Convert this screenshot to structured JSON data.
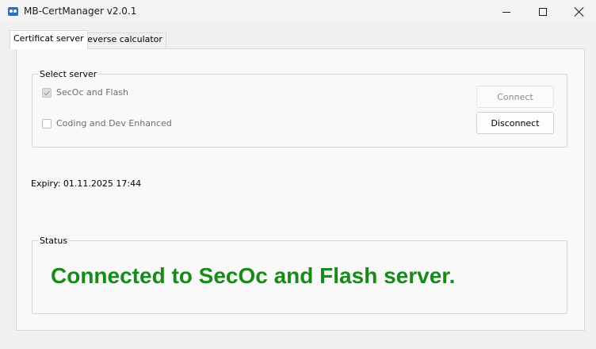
{
  "window": {
    "title": "MB-CertManager v2.0.1",
    "icon": "app-icon",
    "controls": [
      "minimize-icon",
      "maximize-icon",
      "close-icon"
    ]
  },
  "tabs": [
    {
      "label": "Certificat server",
      "active": true
    },
    {
      "label": "Reverse calculator",
      "active": false
    }
  ],
  "select_server": {
    "legend": "Select server",
    "options": [
      {
        "label": "SecOc and Flash",
        "checked": true,
        "enabled": false
      },
      {
        "label": "Coding and Dev Enhanced",
        "checked": false,
        "enabled": true
      }
    ],
    "connect_label": "Connect",
    "disconnect_label": "Disconnect"
  },
  "expiry": "Expiry: 01.11.2025 17:44",
  "status": {
    "legend": "Status",
    "message": "Connected to SecOc and Flash server.",
    "color": "#188a1a"
  },
  "colors": {
    "status_green": "#188a1a",
    "app_icon": "#2f6fb5"
  }
}
